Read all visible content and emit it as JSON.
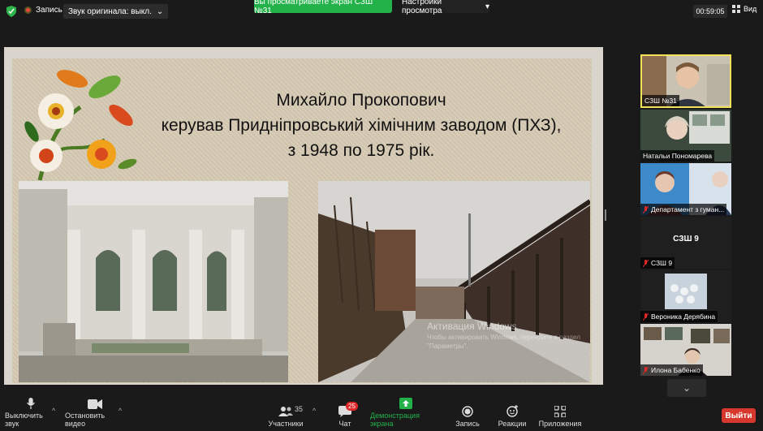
{
  "topbar": {
    "record_label": "Запись",
    "audio_label": "Звук оригинала: выкл.",
    "share_notice": "Вы просматриваете экран СЗШ №31",
    "view_options": "Настройки просмотра",
    "timer": "00:59:05",
    "view_label": "Вид"
  },
  "slide": {
    "title_line1": "Михайло Прокопович",
    "title_line2": "керував Придніпровський хімічним заводом (ПХЗ),",
    "title_line3": "з 1948 по 1975 рік."
  },
  "watermark": {
    "title": "Активация Windows",
    "sub": "Чтобы активировать Windows, перейдите в раздел \"Параметры\"."
  },
  "participants": [
    {
      "name": "СЗШ №31",
      "muted": false,
      "active": true
    },
    {
      "name": "Натальи Пономарева",
      "muted": false,
      "active": false
    },
    {
      "name": "Департамент з гуман...",
      "muted": true,
      "active": false
    },
    {
      "name": "СЗШ 9",
      "center": "СЗШ 9",
      "muted": true,
      "active": false
    },
    {
      "name": "Вероника Дерябина",
      "muted": true,
      "active": false
    },
    {
      "name": "Илона Бабенко",
      "muted": true,
      "active": false
    }
  ],
  "toolbar": {
    "mute": "Выключить звук",
    "video": "Остановить видео",
    "participants": "Участники",
    "participants_count": "35",
    "chat": "Чат",
    "chat_badge": "25",
    "share": "Демонстрация экрана",
    "record": "Запись",
    "reactions": "Реакции",
    "apps": "Приложения",
    "exit": "Выйти"
  },
  "colors": {
    "share_green": "#23b24a",
    "exit_red": "#d6382d",
    "active_border": "#f2e25b"
  }
}
